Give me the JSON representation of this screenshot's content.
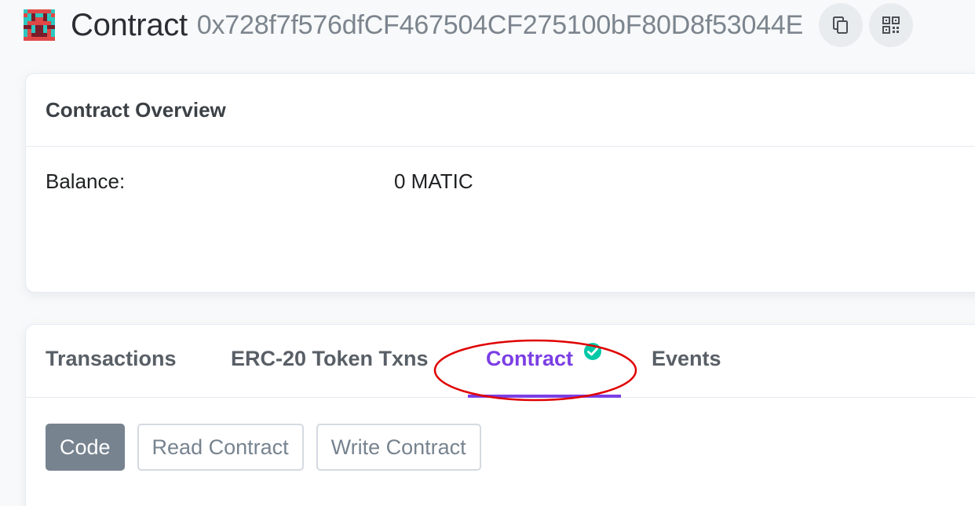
{
  "header": {
    "title": "Contract",
    "address": "0x728f7f576dfCF467504CF275100bF80D8f53044E",
    "avatar_icon": "identicon-avatar",
    "copy_icon": "copy-icon",
    "qr_icon": "qr-code-icon"
  },
  "overview": {
    "title": "Contract Overview",
    "balance_label": "Balance:",
    "balance_value": "0 MATIC"
  },
  "tabs": {
    "items": [
      {
        "label": "Transactions"
      },
      {
        "label": "ERC-20 Token Txns"
      },
      {
        "label": "Contract",
        "active": true,
        "verified_icon": "check-circle-icon"
      },
      {
        "label": "Events"
      }
    ]
  },
  "contract_tabs": {
    "items": [
      {
        "label": "Code",
        "active": true
      },
      {
        "label": "Read Contract"
      },
      {
        "label": "Write Contract"
      }
    ]
  },
  "colors": {
    "accent": "#7b3fe4",
    "verified": "#00c9a7",
    "annotation": "#e00000",
    "active_button": "#77838f"
  }
}
